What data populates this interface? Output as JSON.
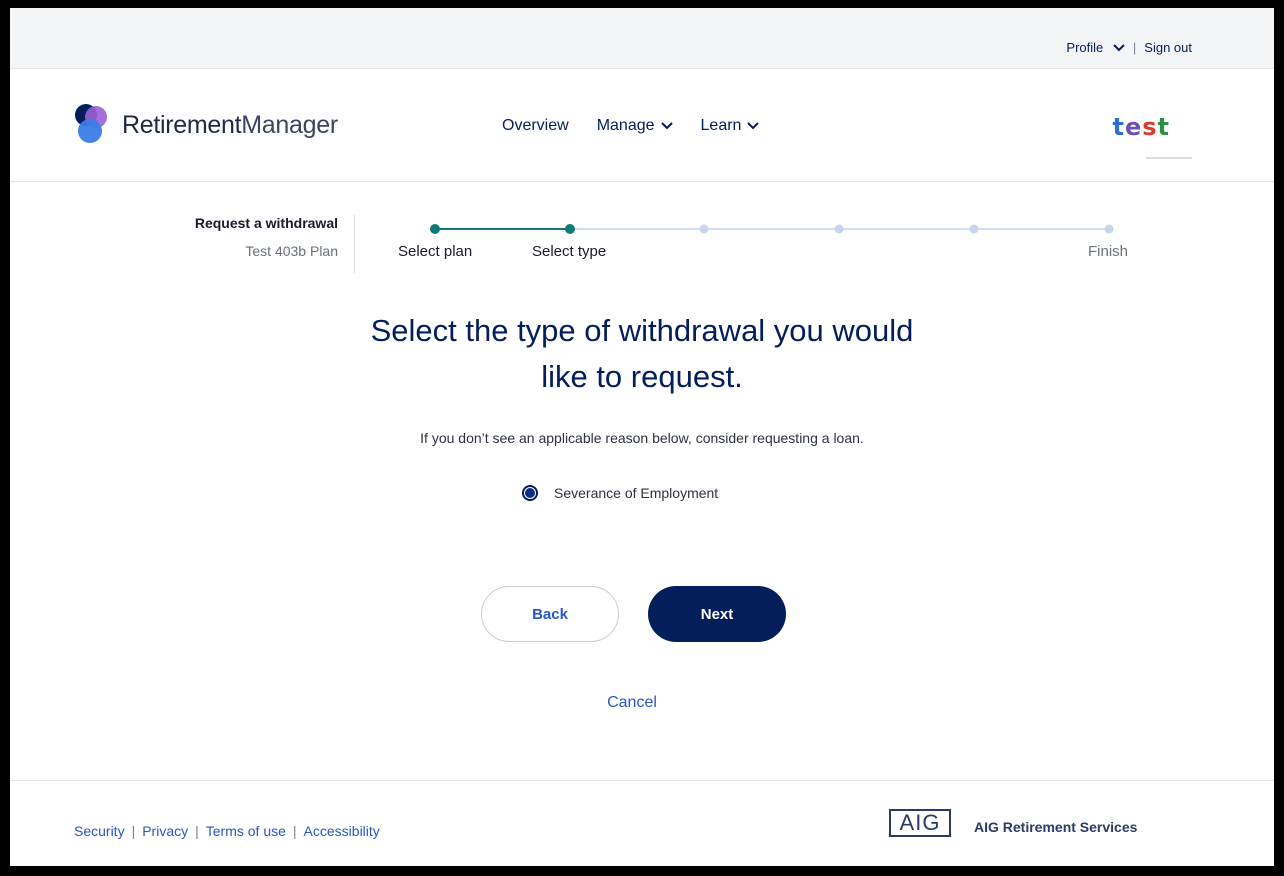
{
  "utility": {
    "profile": "Profile",
    "separator": "|",
    "sign_out": "Sign out"
  },
  "header": {
    "logo_word1": "Retirement",
    "logo_word2": "Manager",
    "nav": [
      "Overview",
      "Manage",
      "Learn"
    ],
    "brand_letters": [
      "t",
      "e",
      "s",
      "t"
    ],
    "brand_colors": [
      "#2f6fd6",
      "#6c4fb3",
      "#d93a2b",
      "#2f8f46"
    ]
  },
  "progress": {
    "title": "Request a withdrawal",
    "plan": "Test 403b Plan",
    "steps": [
      {
        "label": "Select plan",
        "state": "complete"
      },
      {
        "label": "Select type",
        "state": "current"
      },
      {
        "label": "",
        "state": "upcoming"
      },
      {
        "label": "",
        "state": "upcoming"
      },
      {
        "label": "",
        "state": "upcoming"
      },
      {
        "label": "Finish",
        "state": "upcoming"
      }
    ]
  },
  "main": {
    "title_line1": "Select the type of withdrawal you would",
    "title_line2": "like to request.",
    "hint": "If you don’t see an applicable reason below, consider requesting a loan.",
    "option": "Severance of Employment",
    "option_selected": true,
    "back": "Back",
    "next": "Next",
    "cancel": "Cancel"
  },
  "footer": {
    "links": [
      "Security",
      "Privacy",
      "Terms of use",
      "Accessibility"
    ],
    "separator": "|",
    "aig_logo": "AIG",
    "aig_text": "AIG Retirement Services"
  },
  "colors": {
    "navy": "#041e5b",
    "link": "#2a56c6",
    "teal": "#127a75",
    "step_upcoming": "#c6d6ea"
  }
}
